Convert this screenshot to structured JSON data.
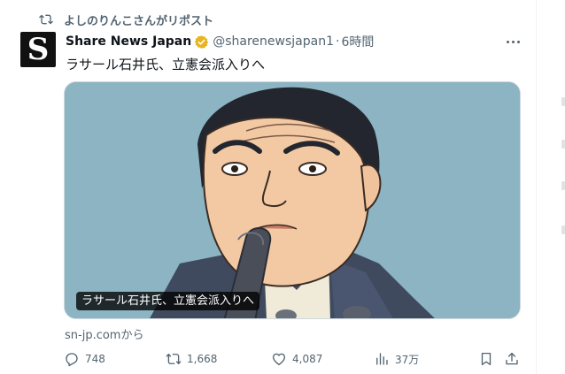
{
  "repost": {
    "text": "よしのりんこさんがリポスト",
    "icon": "repost-icon"
  },
  "author": {
    "avatar_letter": "S",
    "display_name": "Share News Japan",
    "handle": "@sharenewsjapan1",
    "separator": "·",
    "time": "6時間",
    "verified_color": "#e8b422"
  },
  "tweet": {
    "text": "ラサール石井氏、立憲会派入りへ",
    "media_caption": "ラサール石井氏、立憲会派入りへ",
    "source": "sn-jp.comから"
  },
  "actions": {
    "replies": "748",
    "reposts": "1,668",
    "likes": "4,087",
    "views": "37万"
  },
  "colors": {
    "text_secondary": "#536471",
    "media_bg": "#8cb4c3"
  }
}
